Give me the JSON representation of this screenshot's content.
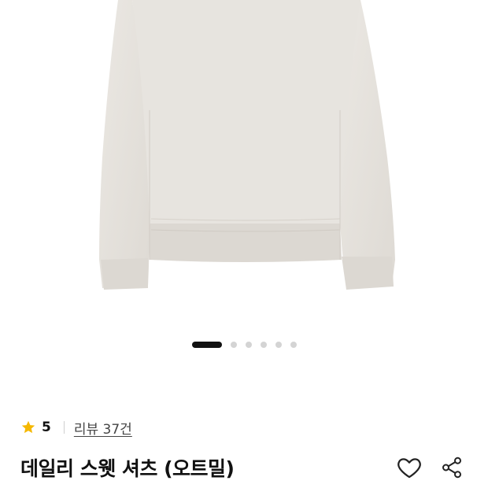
{
  "gallery": {
    "image_alt": "sweatshirt-oatmeal",
    "total_images": 6,
    "active_index": 0
  },
  "product": {
    "rating": "5",
    "review_link": "리뷰 37건",
    "title": "데일리 스웻 셔츠 (오트밀)"
  },
  "icons": {
    "rating": "star-icon",
    "wishlist": "heart-icon",
    "share": "share-icon"
  },
  "colors": {
    "star": "#F5B800",
    "dot_active": "#111111",
    "dot_inactive": "#D4D4D4",
    "product_fabric": "#E6E3DE"
  }
}
